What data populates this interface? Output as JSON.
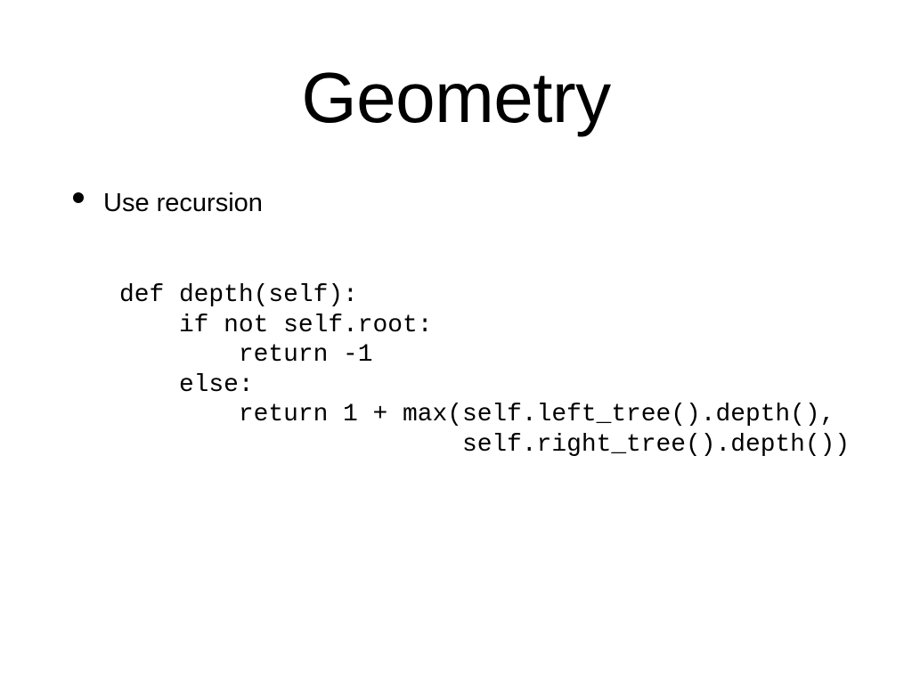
{
  "slide": {
    "title": "Geometry",
    "bullets": [
      {
        "text": "Use recursion"
      }
    ],
    "code": {
      "language": "python",
      "lines": [
        "def depth(self):",
        "    if not self.root:",
        "        return -1",
        "    else:",
        "        return 1 + max(self.left_tree().depth(),",
        "                       self.right_tree().depth())"
      ]
    }
  }
}
